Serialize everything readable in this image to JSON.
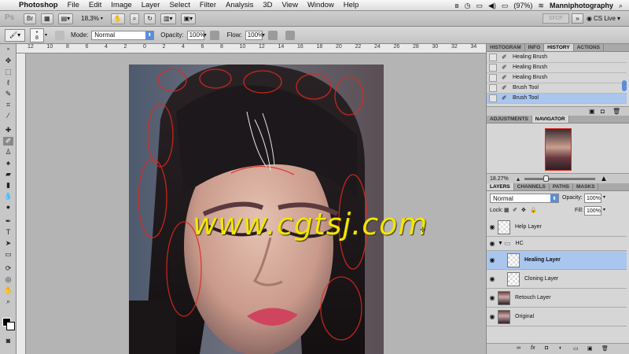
{
  "menubar": {
    "app": "Photoshop",
    "menus": [
      "File",
      "Edit",
      "Image",
      "Layer",
      "Select",
      "Filter",
      "Analysis",
      "3D",
      "View",
      "Window",
      "Help"
    ],
    "battery": "(97%)",
    "user": "Manniphotography"
  },
  "appbar": {
    "zoom": "18,3%",
    "workspace": "SFDF",
    "cs_live": "CS Live"
  },
  "options": {
    "brush_size": "8",
    "mode_label": "Mode:",
    "mode_value": "Normal",
    "opacity_label": "Opacity:",
    "opacity_value": "100%",
    "flow_label": "Flow:",
    "flow_value": "100%"
  },
  "ruler": {
    "ticks": [
      "12",
      "10",
      "8",
      "6",
      "4",
      "2",
      "0",
      "2",
      "4",
      "6",
      "8",
      "10",
      "12",
      "14",
      "16",
      "18",
      "20",
      "22",
      "24",
      "26",
      "28",
      "30",
      "32",
      "34"
    ]
  },
  "canvas": {
    "watermark": "www.cgtsj.com"
  },
  "history_panel": {
    "tabs": [
      "HISTOGRAM",
      "INFO",
      "HISTORY",
      "ACTIONS"
    ],
    "active_tab": "HISTORY",
    "items": [
      {
        "label": "Healing Brush"
      },
      {
        "label": "Healing Brush"
      },
      {
        "label": "Healing Brush"
      },
      {
        "label": "Brush Tool"
      },
      {
        "label": "Brush Tool"
      }
    ]
  },
  "navigator_panel": {
    "tabs": [
      "ADJUSTMENTS",
      "NAVIGATOR"
    ],
    "active_tab": "NAVIGATOR",
    "zoom": "18.27%"
  },
  "layers_panel": {
    "tabs": [
      "LAYERS",
      "CHANNELS",
      "PATHS",
      "MASKS"
    ],
    "active_tab": "LAYERS",
    "blend_mode": "Normal",
    "opacity_label": "Opacity:",
    "opacity_value": "100%",
    "lock_label": "Lock:",
    "fill_label": "Fill:",
    "fill_value": "100%",
    "layers": [
      {
        "name": "Help Layer"
      },
      {
        "name": "HC"
      },
      {
        "name": "Healing Layer"
      },
      {
        "name": "Cloning Layer"
      },
      {
        "name": "Retouch Layer"
      },
      {
        "name": "Original"
      }
    ]
  },
  "colors": {
    "selection": "#a9c6ee",
    "watermark": "#f3e600",
    "stroke": "#e0281e"
  }
}
